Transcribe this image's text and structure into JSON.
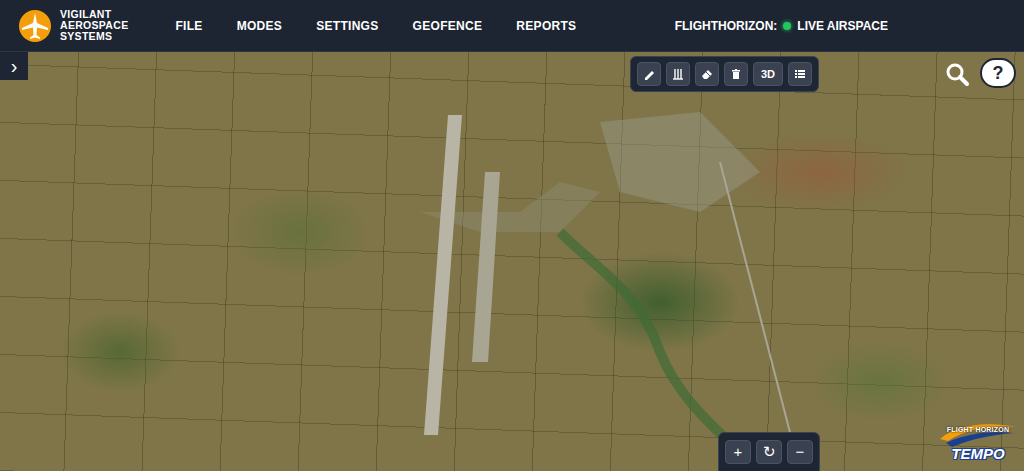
{
  "header": {
    "brand": [
      "VIGILANT",
      "AEROSPACE",
      "SYSTEMS"
    ],
    "menu": [
      "FILE",
      "MODES",
      "SETTINGS",
      "GEOFENCE",
      "REPORTS"
    ],
    "status": {
      "label": "FLIGHTHORIZON:",
      "value": "LIVE AIRSPACE",
      "live": true
    }
  },
  "sidebar": {
    "toggle": "›",
    "expanded": false
  },
  "toolbar": {
    "tools": [
      {
        "kind": "icon"
      },
      {
        "kind": "icon"
      },
      {
        "kind": "icon"
      },
      {
        "kind": "icon"
      },
      {
        "kind": "text",
        "label": "3D"
      },
      {
        "kind": "icon"
      }
    ]
  },
  "help": {
    "label": "?"
  },
  "zoom": {
    "buttons": [
      "+",
      "↻",
      "−"
    ]
  },
  "logo": {
    "top": "FLIGHT HORIZON",
    "bottom": "TEMPO"
  }
}
